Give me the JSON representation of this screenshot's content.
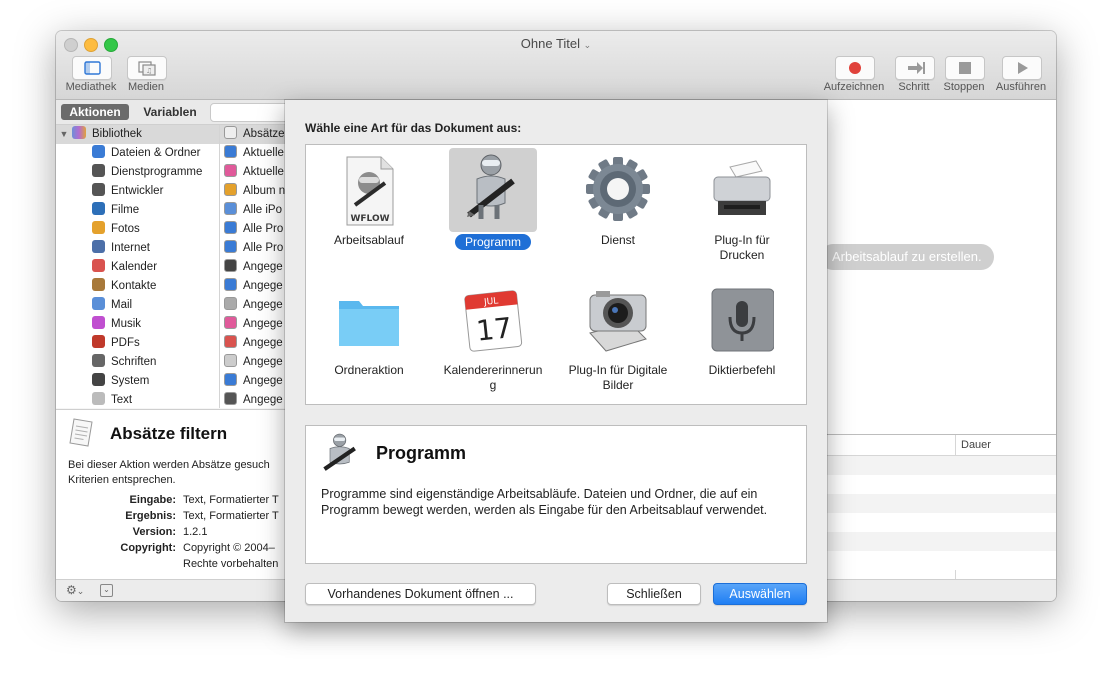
{
  "window": {
    "title": "Ohne Titel",
    "toolbar_left": [
      {
        "label": "Mediathek",
        "icon": "sidebar-icon"
      },
      {
        "label": "Medien",
        "icon": "media-icon"
      }
    ],
    "toolbar_right": [
      {
        "label": "Aufzeichnen",
        "icon": "record-icon"
      },
      {
        "label": "Schritt",
        "icon": "step-icon"
      },
      {
        "label": "Stoppen",
        "icon": "stop-icon"
      },
      {
        "label": "Ausführen",
        "icon": "play-icon"
      }
    ]
  },
  "left_panel": {
    "tabs": {
      "actions": "Aktionen",
      "variables": "Variablen"
    },
    "library_root": "Bibliothek",
    "library_items": [
      "Dateien & Ordner",
      "Dienstprogramme",
      "Entwickler",
      "Filme",
      "Fotos",
      "Internet",
      "Kalender",
      "Kontakte",
      "Mail",
      "Musik",
      "PDFs",
      "Schriften",
      "System",
      "Text"
    ],
    "actions": [
      "Absätze",
      "Aktuelle",
      "Aktuelle",
      "Album n",
      "Alle iPo",
      "Alle Pro",
      "Alle Pro",
      "Angege",
      "Angege",
      "Angege",
      "Angege",
      "Angege",
      "Angege",
      "Angege",
      "Angege"
    ],
    "description": {
      "title": "Absätze filtern",
      "text": "Bei dieser Aktion werden Absätze gesuch Kriterien entsprechen.",
      "fields": [
        {
          "key": "Eingabe:",
          "value": "Text, Formatierter T"
        },
        {
          "key": "Ergebnis:",
          "value": "Text, Formatierter T"
        },
        {
          "key": "Version:",
          "value": "1.2.1"
        },
        {
          "key": "Copyright:",
          "value": "Copyright © 2004–"
        },
        {
          "key": "",
          "value": "Rechte vorbehalten"
        }
      ]
    }
  },
  "workflow": {
    "hint": "Arbeitsablauf zu erstellen.",
    "log_column": "Dauer"
  },
  "sheet": {
    "prompt": "Wähle eine Art für das Dokument aus:",
    "types": [
      {
        "label": "Arbeitsablauf",
        "icon": "workflow-file-icon",
        "badge": "WFLOW",
        "selected": false
      },
      {
        "label": "Programm",
        "icon": "automator-robot-icon",
        "selected": true
      },
      {
        "label": "Dienst",
        "icon": "gear-icon",
        "selected": false
      },
      {
        "label": "Plug-In für Drucken",
        "icon": "printer-icon",
        "selected": false
      },
      {
        "label": "Ordneraktion",
        "icon": "folder-icon",
        "selected": false
      },
      {
        "label": "Kalendererinnerung",
        "icon": "calendar-icon",
        "month": "JUL",
        "day": "17",
        "selected": false
      },
      {
        "label": "Plug-In für Digitale Bilder",
        "icon": "camera-icon",
        "selected": false
      },
      {
        "label": "Diktierbefehl",
        "icon": "microphone-icon",
        "selected": false
      }
    ],
    "info": {
      "title": "Programm",
      "text": "Programme sind eigenständige Arbeitsabläufe. Dateien und Ordner, die auf ein Programm bewegt werden, werden als Eingabe für den Arbeitsablauf verwendet."
    },
    "buttons": {
      "open": "Vorhandenes Dokument öffnen ...",
      "close": "Schließen",
      "choose": "Auswählen"
    }
  },
  "colors": {
    "accent": "#1f7ef3",
    "selection": "#d0d0d0",
    "tab_selected": "#6b6b6b"
  }
}
